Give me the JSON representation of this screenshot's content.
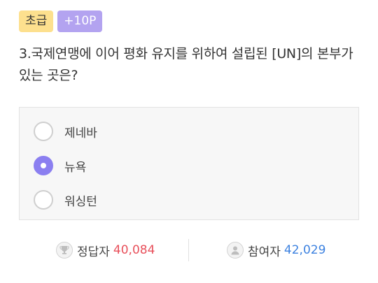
{
  "badges": {
    "level": "초급",
    "points": "+10P"
  },
  "question": "3.국제연맹에 이어 평화 유지를 위하여 설립된 [UN]의 본부가 있는 곳은?",
  "options": [
    {
      "label": "제네바",
      "selected": false
    },
    {
      "label": "뉴욕",
      "selected": true
    },
    {
      "label": "워싱턴",
      "selected": false
    }
  ],
  "stats": {
    "correct_label": "정답자",
    "correct_value": "40,084",
    "participants_label": "참여자",
    "participants_value": "42,029"
  },
  "colors": {
    "level_badge": "#fde08e",
    "points_badge": "#b3a3f0",
    "selected_radio": "#8b7ff0",
    "correct_value": "#e8505b",
    "participants_value": "#3d82e0"
  },
  "icons": {
    "correct": "trophy-icon",
    "participants": "user-icon"
  }
}
